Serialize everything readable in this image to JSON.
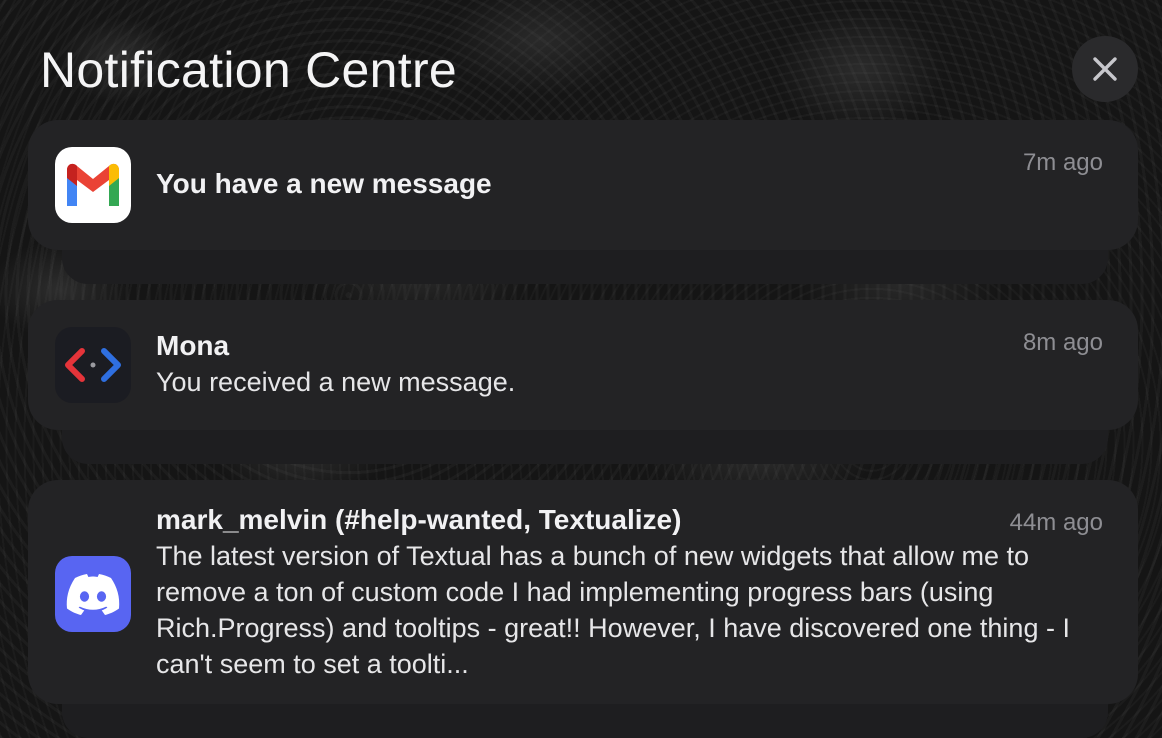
{
  "header": {
    "title": "Notification Centre",
    "close_icon": "close-icon"
  },
  "notifications": [
    {
      "app": "Gmail",
      "icon": "gmail-icon",
      "title": "You have a new message",
      "body": "",
      "time": "7m ago",
      "stacked": true
    },
    {
      "app": "Mona",
      "icon": "mona-icon",
      "title": "Mona",
      "body": "You received a new message.",
      "time": "8m ago",
      "stacked": true
    },
    {
      "app": "Discord",
      "icon": "discord-icon",
      "title": "mark_melvin (#help-wanted, Textualize)",
      "body": "The latest version of Textual has a bunch of new widgets that allow me to remove a ton of custom code I had implementing progress bars (using Rich.Progress) and tooltips - great!! However, I have discovered one thing - I can't seem to set a toolti...",
      "time": "44m ago",
      "stacked": true
    }
  ],
  "colors": {
    "card_background": "#232325",
    "gmail_red": "#ea4335",
    "gmail_blue": "#4285f4",
    "gmail_green": "#34a853",
    "gmail_yellow": "#fbbc04",
    "mona_red": "#e5343a",
    "mona_blue": "#2f6fe0",
    "discord_blurple": "#5865f2"
  }
}
